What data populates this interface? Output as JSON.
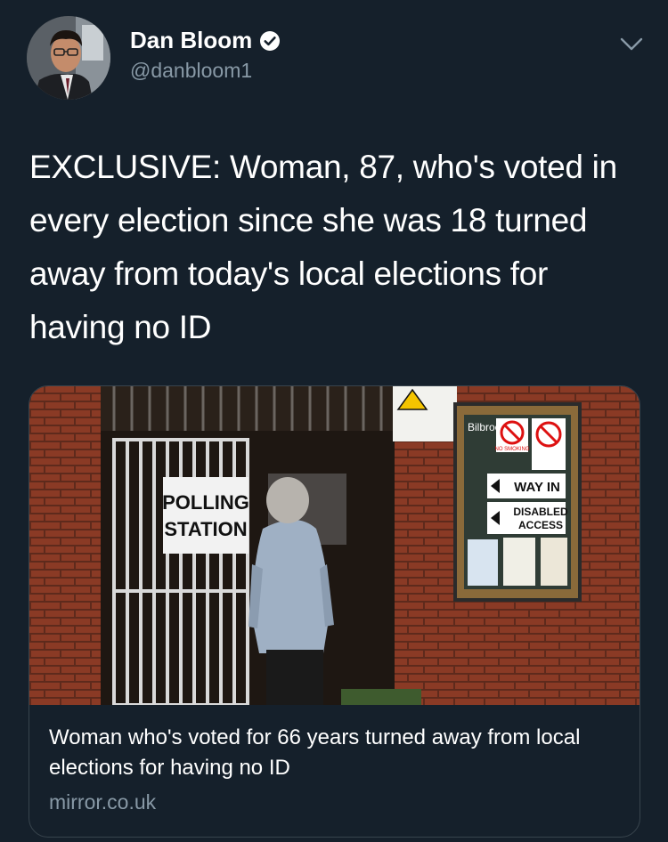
{
  "tweet": {
    "author": {
      "name": "Dan Bloom",
      "handle": "@danbloom1",
      "verified": true
    },
    "text": "EXCLUSIVE: Woman, 87, who's voted in every election since she was 18 turned away from today's local elections for having no ID",
    "card": {
      "title": "Woman who's voted for 66 years turned away from local elections for having no ID",
      "domain": "mirror.co.uk",
      "image_signs": {
        "polling_line1": "POLLING",
        "polling_line2": "STATION",
        "way_in": "WAY IN",
        "disabled_line1": "DISABLED",
        "disabled_line2": "ACCESS",
        "notice_board_header": "Bilbroc",
        "no_smoking": "NO SMOKING"
      }
    }
  },
  "icons": {
    "verified": "verified-badge-icon",
    "menu": "chevron-down-icon"
  },
  "colors": {
    "background": "#15202b",
    "secondary_text": "#8899a6",
    "border": "#38444d",
    "verified": "#ffffff"
  }
}
